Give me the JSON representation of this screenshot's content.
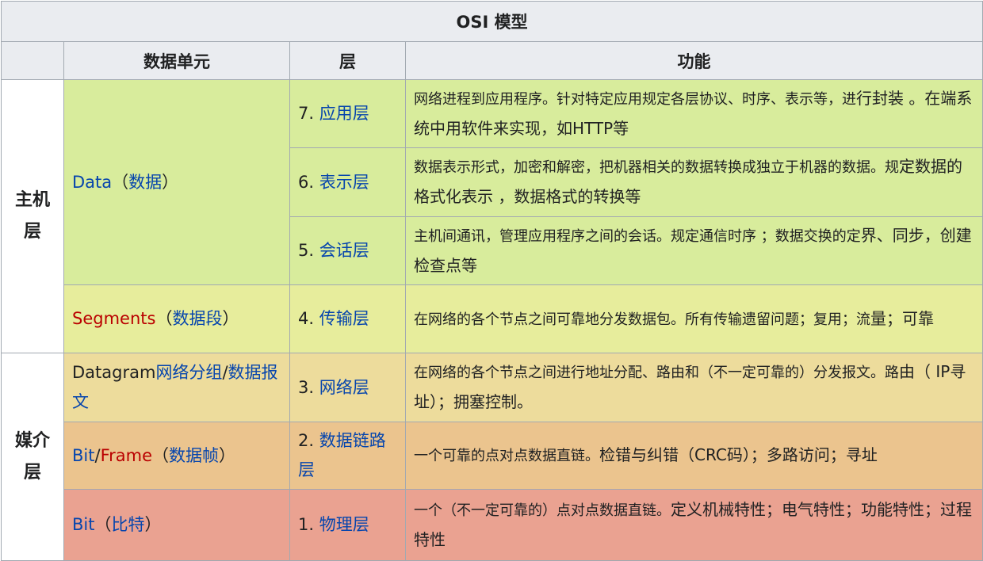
{
  "title": "OSI 模型",
  "headers": {
    "unit": "数据单元",
    "layer": "层",
    "function": "功能"
  },
  "groups": {
    "host": "主机层",
    "media": "媒介层"
  },
  "colors": {
    "green": "#d8ec9c",
    "yellow": "#e7ed9c",
    "sand": "#eddc9c",
    "orange": "#ebc48e",
    "salmon": "#eaa291",
    "link": "#0645ad",
    "red": "#ba0000"
  },
  "units": {
    "data": {
      "en": "Data",
      "paren_open": "（",
      "zh": "数据",
      "paren_close": "）"
    },
    "segments": {
      "en": "Segments",
      "paren_open": "（",
      "zh": "数据段",
      "paren_close": "）"
    },
    "datagram": {
      "en": "Datagram",
      "zh1": "网络分组",
      "slash": "/",
      "zh2": "数据报文"
    },
    "frame": {
      "en1": "Bit",
      "slash": "/",
      "en2": "Frame",
      "paren_open": "（",
      "zh": "数据帧",
      "paren_close": "）"
    },
    "bit": {
      "en": "Bit",
      "paren_open": "（",
      "zh": "比特",
      "paren_close": "）"
    }
  },
  "layers": [
    {
      "num": "7. ",
      "name": "应用层",
      "function_small": "网络进程到应用程序。针对特定应用规定各层协议、时序、表示等，进",
      "function_big": "行封装 。在端系统中用软件来实现，如HTTP等"
    },
    {
      "num": "6. ",
      "name": "表示层",
      "function_small": "数据表示形式，加密和解密，把机器相关的数据转换成独立于机器的数据。规",
      "function_big": "定数据的格式化表示 ，数据格式的转换等"
    },
    {
      "num": "5. ",
      "name": "会话层",
      "function_small": "主机间通讯，管理应用程序之间的会话。规定通信时序 ；数据交换的定",
      "function_big": "界、同步，创建检查点等"
    },
    {
      "num": "4. ",
      "name": "传输层",
      "function_small": "在网络的各个节点之间可靠地分发数据包。所有传输遗留问题；复用；流",
      "function_big": "量；可靠"
    },
    {
      "num": "3. ",
      "name": "网络层",
      "function_small": "在网络的各个节点之间进行地址分配、路由和（不一定可靠的）分发报文。路",
      "function_big": "由（ IP寻址）；拥塞控制。"
    },
    {
      "num": "2. ",
      "name": "数据链路层",
      "function_small": "一个可靠的点对点数据直链。",
      "function_big": "检错与纠错（CRC码）；多路访问；寻址"
    },
    {
      "num": "1. ",
      "name": "物理层",
      "function_small": "一个（不一定可靠的）点对点数据直链。",
      "function_big": "定义机械特性；电气特性；功能特性；过程特性"
    }
  ]
}
